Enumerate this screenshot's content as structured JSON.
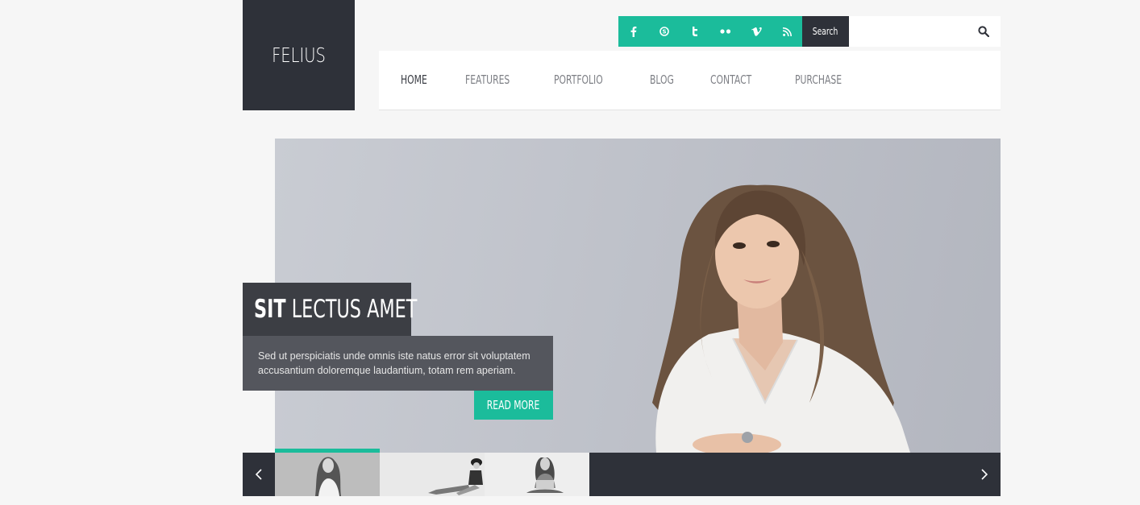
{
  "logo": {
    "text": "FELIUS"
  },
  "social": {
    "items": [
      {
        "name": "facebook-icon",
        "glyph": "f"
      },
      {
        "name": "skype-icon",
        "glyph": "S"
      },
      {
        "name": "twitter-icon",
        "glyph": "t"
      },
      {
        "name": "flickr-icon",
        "glyph": "••"
      },
      {
        "name": "vimeo-icon",
        "glyph": "v"
      },
      {
        "name": "rss-icon",
        "glyph": "rss"
      }
    ]
  },
  "search": {
    "label": "Search",
    "value": "",
    "placeholder": ""
  },
  "nav": {
    "items": [
      {
        "label": "HOME",
        "active": true
      },
      {
        "label": "FEATURES"
      },
      {
        "label": "PORTFOLIO"
      },
      {
        "label": "BLOG"
      },
      {
        "label": "CONTACT"
      },
      {
        "label": "PURCHASE"
      }
    ]
  },
  "slide": {
    "title_bold": "SIT",
    "title_rest": "LECTUS AMET",
    "text": "Sed ut perspiciatis unde omnis iste natus error sit voluptatem accusantium doloremque laudantium, totam rem aperiam.",
    "button": "READ MORE"
  },
  "thumbs": {
    "active_index": 0,
    "count": 3
  },
  "colors": {
    "accent": "#1bbc9b",
    "dark": "#2e3139",
    "caption_dark": "#3c3e44",
    "caption_text_bg": "#54565d"
  }
}
